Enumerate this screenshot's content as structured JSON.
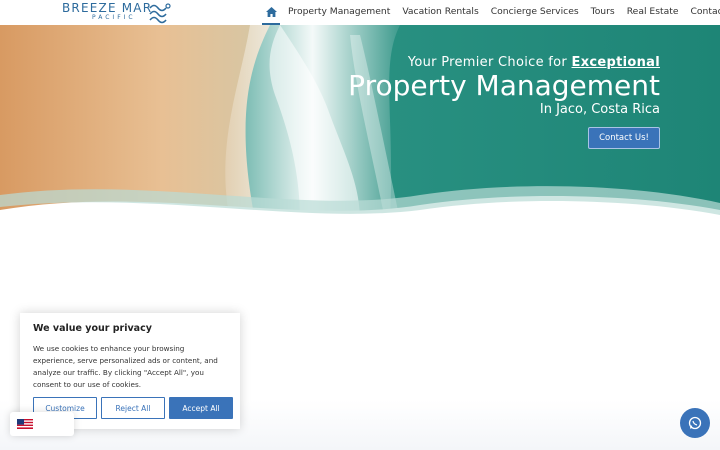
{
  "logo": {
    "name": "BREEZE MAR",
    "sub": "PACIFIC"
  },
  "nav": {
    "home_icon": "home-icon",
    "items": [
      {
        "label": "Property Management"
      },
      {
        "label": "Vacation Rentals"
      },
      {
        "label": "Concierge Services"
      },
      {
        "label": "Tours"
      },
      {
        "label": "Real Estate"
      },
      {
        "label": "Contact Us"
      }
    ]
  },
  "hero": {
    "line1_prefix": "Your Premier Choice for ",
    "line1_emphasis": "Exceptional",
    "line2": "Property Management",
    "line3": "In Jaco, Costa Rica",
    "cta": "Contact Us!"
  },
  "cookie": {
    "title": "We value your privacy",
    "body": "We use cookies to enhance your browsing experience, serve personalized ads or content, and analyze our traffic. By clicking \"Accept All\", you consent to our use of cookies.",
    "customize": "Customize",
    "reject": "Reject All",
    "accept": "Accept All"
  },
  "language_flag": "us-flag-icon",
  "whatsapp_icon": "whatsapp-icon",
  "colors": {
    "accent": "#3a73b9",
    "brand": "#2d6b9d",
    "sea": "#1f8f82",
    "sand": "#e2b07c"
  }
}
